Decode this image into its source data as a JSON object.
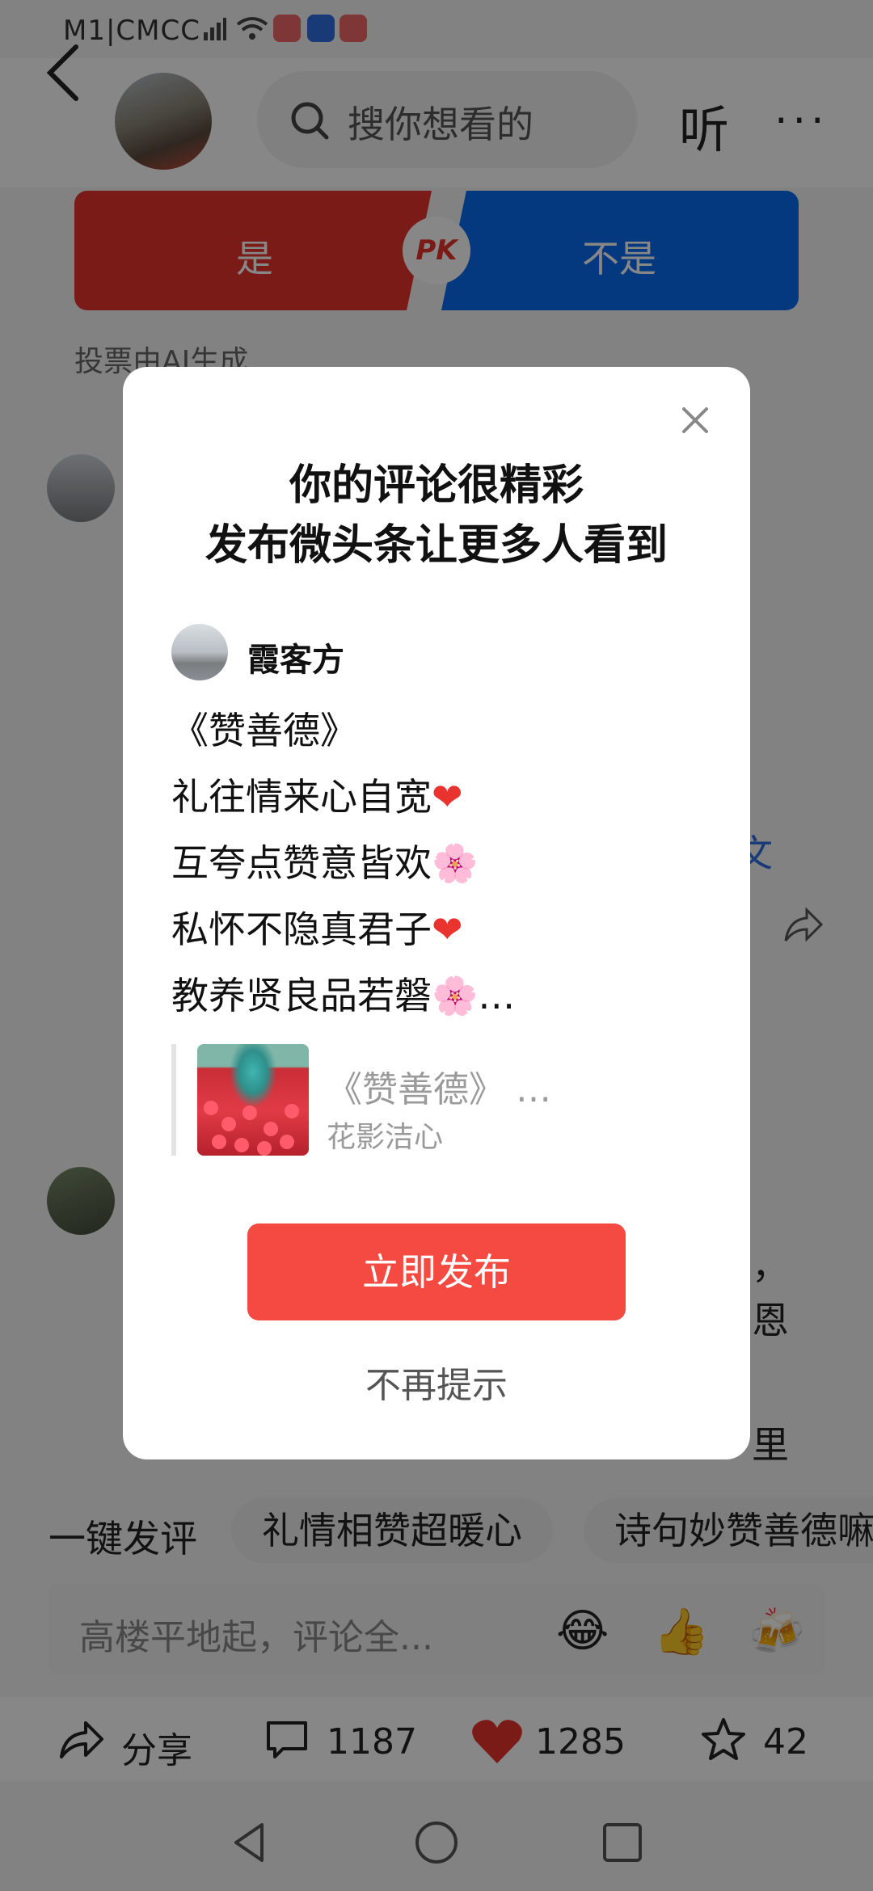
{
  "status_bar": {
    "carrier": "M1|CMCC"
  },
  "header": {
    "search_placeholder": "搜你想看的",
    "listen_label": "听",
    "more_label": "···"
  },
  "pk": {
    "yes_label": "是",
    "no_label": "不是",
    "badge": "PK",
    "note": "投票由AI生成"
  },
  "background": {
    "fragments": [
      "文",
      "，",
      "恩",
      "里"
    ],
    "chips": [
      "一键发评",
      "礼情相赞超暖心",
      "诗句妙赞善德嘛"
    ],
    "comment_placeholder": "高楼平地起，评论全...",
    "emojis": [
      "😂",
      "👍",
      "🍻"
    ],
    "actions": {
      "share_label": "分享",
      "comment_count": "1187",
      "like_count": "1285",
      "fav_count": "42"
    }
  },
  "modal": {
    "title_line1": "你的评论很精彩",
    "title_line2": "发布微头条让更多人看到",
    "user_name": "霞客方",
    "poem_lines": [
      "《赞善德》",
      "礼往情来心自宽",
      "互夸点赞意皆欢",
      "私怀不隐真君子",
      "教养贤良品若磐"
    ],
    "poem_emojis": [
      "",
      "❤",
      "🌸",
      "❤",
      "🌸"
    ],
    "poem_ellipsis": "…",
    "quote": {
      "title": "《赞善德》 …",
      "author": "花影洁心"
    },
    "publish_label": "立即发布",
    "no_remind_label": "不再提示"
  },
  "colors": {
    "red": "#e8332f",
    "blue": "#0b6df0",
    "publish": "#f54a42"
  }
}
